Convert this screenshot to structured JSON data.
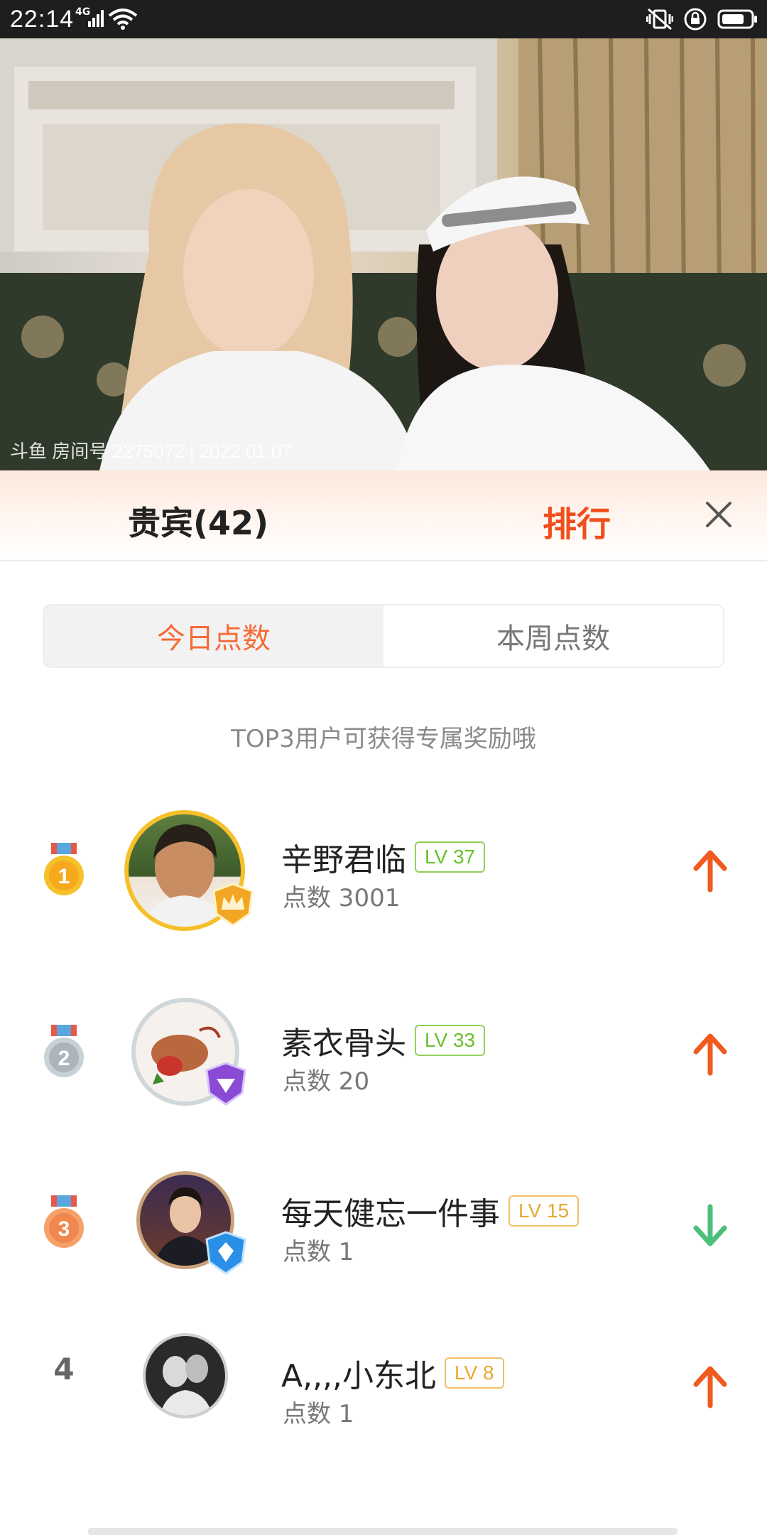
{
  "status_bar": {
    "time": "22:14",
    "network": "4G"
  },
  "video": {
    "watermark": "斗鱼 房间号 2275072 | 2022.01.07"
  },
  "header": {
    "guest_label": "贵宾(42)",
    "rank_label": "排行"
  },
  "tabs": [
    {
      "label": "今日点数",
      "active": true
    },
    {
      "label": "本周点数",
      "active": false
    }
  ],
  "hint": "TOP3用户可获得专属奖励哦",
  "ranking": [
    {
      "rank": "1",
      "name": "辛野君临",
      "level": "LV 37",
      "level_color": "green",
      "points": "点数 3001",
      "trend": "up",
      "badge": "crown"
    },
    {
      "rank": "2",
      "name": "素衣骨头",
      "level": "LV 33",
      "level_color": "green",
      "points": "点数 20",
      "trend": "up",
      "badge": "diamond"
    },
    {
      "rank": "3",
      "name": "每天健忘一件事",
      "level": "LV 15",
      "level_color": "orange",
      "points": "点数 1",
      "trend": "down",
      "badge": "shield"
    },
    {
      "rank": "4",
      "name": "A,,,,小东北",
      "level": "LV 8",
      "level_color": "orange",
      "points": "点数 1",
      "trend": "up",
      "badge": ""
    }
  ],
  "colors": {
    "accent": "#f04e1c",
    "active_tab_text": "#f56a35",
    "trend_up": "#f05a1e",
    "trend_down": "#4cbf7a",
    "gold": "#f5b81c",
    "silver": "#b9c4c9",
    "bronze": "#f0874e"
  }
}
